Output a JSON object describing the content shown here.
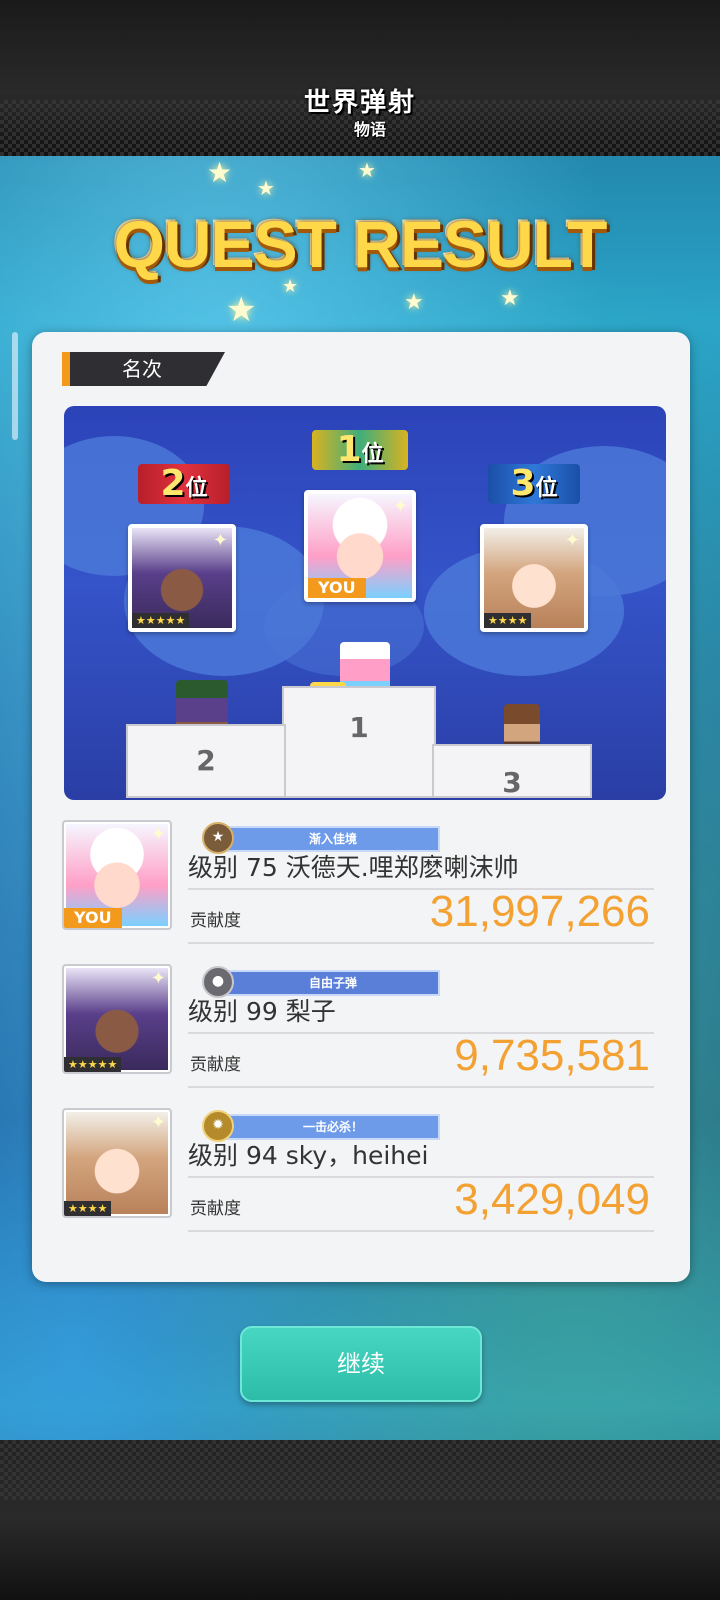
{
  "header": {
    "logo_main": "世界弹射",
    "logo_sub": "物语",
    "title": "QUEST RESULT"
  },
  "section": {
    "label": "名次"
  },
  "podium": {
    "first": {
      "rank_num": "1",
      "rank_suffix": "位",
      "you_badge": "YOU"
    },
    "second": {
      "rank_num": "2",
      "rank_suffix": "位",
      "stars": "★★★★★"
    },
    "third": {
      "rank_num": "3",
      "rank_suffix": "位",
      "stars": "★★★★"
    },
    "step_labels": [
      "1",
      "2",
      "3"
    ]
  },
  "results": [
    {
      "title_badge": "渐入佳境",
      "name": "级别 75 沃德天.哩郑麽喇沫帅",
      "contrib_label": "贡献度",
      "contrib_value": "31,997,266",
      "you_badge": "YOU"
    },
    {
      "title_badge": "自由子弹",
      "name": "级别 99 梨子",
      "contrib_label": "贡献度",
      "contrib_value": "9,735,581",
      "stars": "★★★★★"
    },
    {
      "title_badge": "一击必杀！",
      "name": "级别 94 sky，heihei",
      "contrib_label": "贡献度",
      "contrib_value": "3,429,049",
      "stars": "★★★★"
    }
  ],
  "buttons": {
    "continue_label": "继续"
  },
  "colors": {
    "accent_orange": "#f39a1c",
    "contrib_orange": "#f3a133",
    "continue_teal": "#2cbca8",
    "title_gold": "#ffd84a"
  },
  "icons": [
    "sparkle-icon",
    "star-icon",
    "emblem-icon"
  ]
}
